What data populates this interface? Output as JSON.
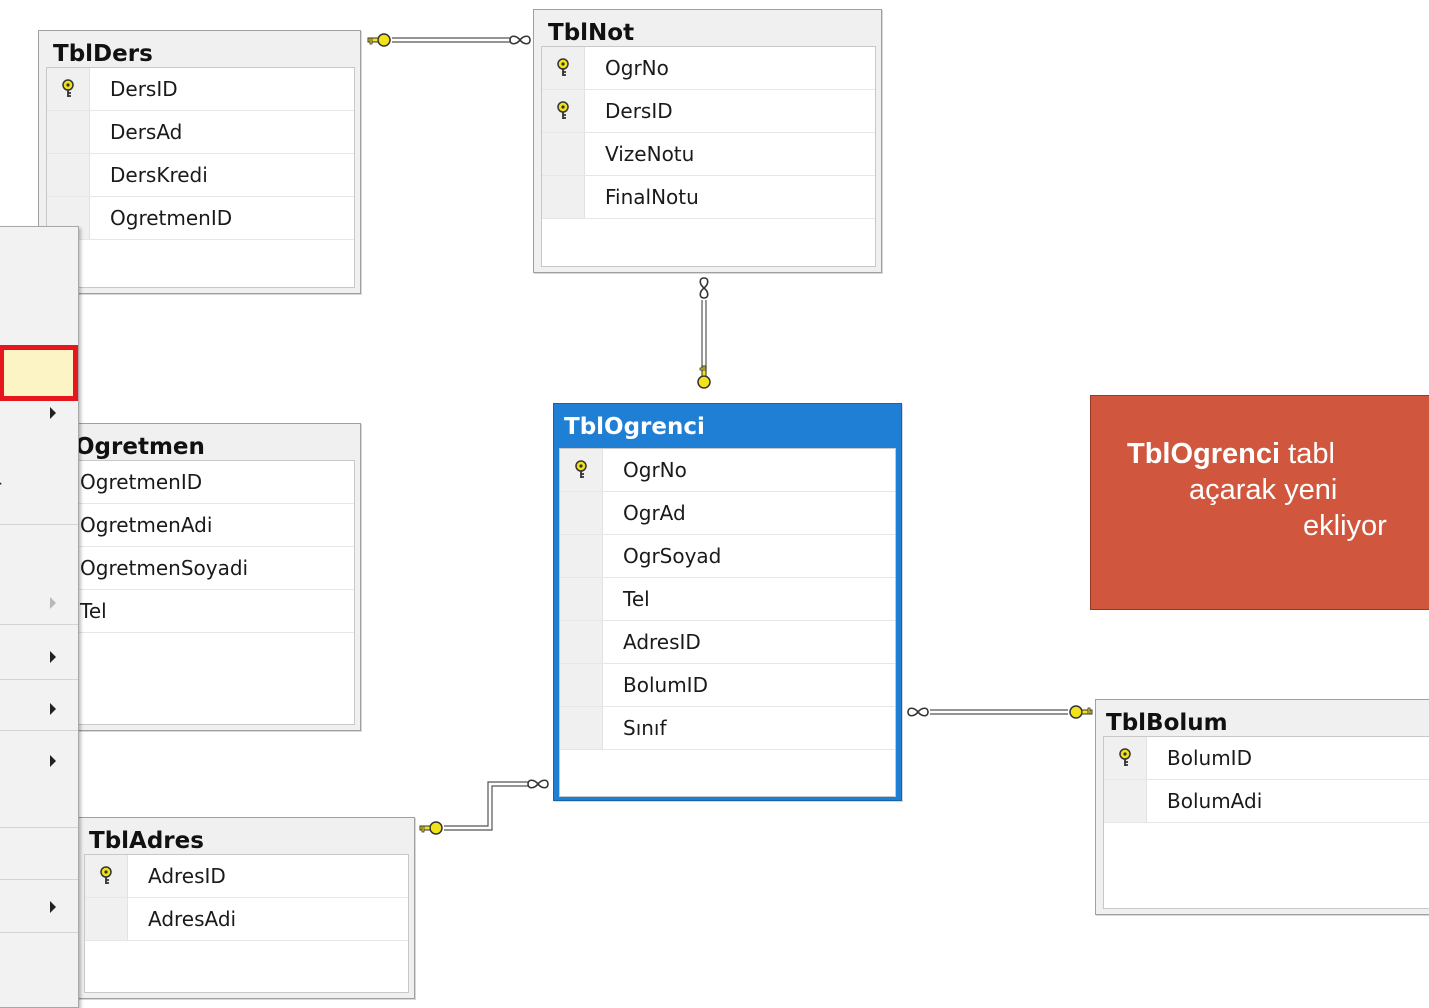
{
  "tables": {
    "tblders": {
      "title": "TblDers",
      "columns": [
        "DersID",
        "DersAd",
        "DersKredi",
        "OgretmenID"
      ]
    },
    "tblnot": {
      "title": "TblNot",
      "columns": [
        "OgrNo",
        "DersID",
        "VizeNotu",
        "FinalNotu"
      ]
    },
    "tblogretmen": {
      "title": "Ogretmen",
      "columns": [
        "OgretmenID",
        "OgretmenAdi",
        "OgretmenSoyadi",
        "Tel"
      ]
    },
    "tblogrenci": {
      "title": "TblOgrenci",
      "columns": [
        "OgrNo",
        "OgrAd",
        "OgrSoyad",
        "Tel",
        "AdresID",
        "BolumID",
        "Sınıf"
      ]
    },
    "tbladres": {
      "title": "TblAdres",
      "columns": [
        "AdresID",
        "AdresAdi"
      ]
    },
    "tblbolum": {
      "title": "TblBolum",
      "columns": [
        "BolumID",
        "BolumAdi"
      ]
    }
  },
  "context_menu": {
    "visible_fragment": "r"
  },
  "callout": {
    "bold": "TblOgrenci",
    "line1_rest": " tabl",
    "line2": "açarak yeni",
    "line3": "ekliyor"
  },
  "colors": {
    "selected_table": "#1f7fd4",
    "callout_bg": "#d0573d",
    "highlight_border": "#e8151e",
    "key_icon": "#f2e21a"
  }
}
